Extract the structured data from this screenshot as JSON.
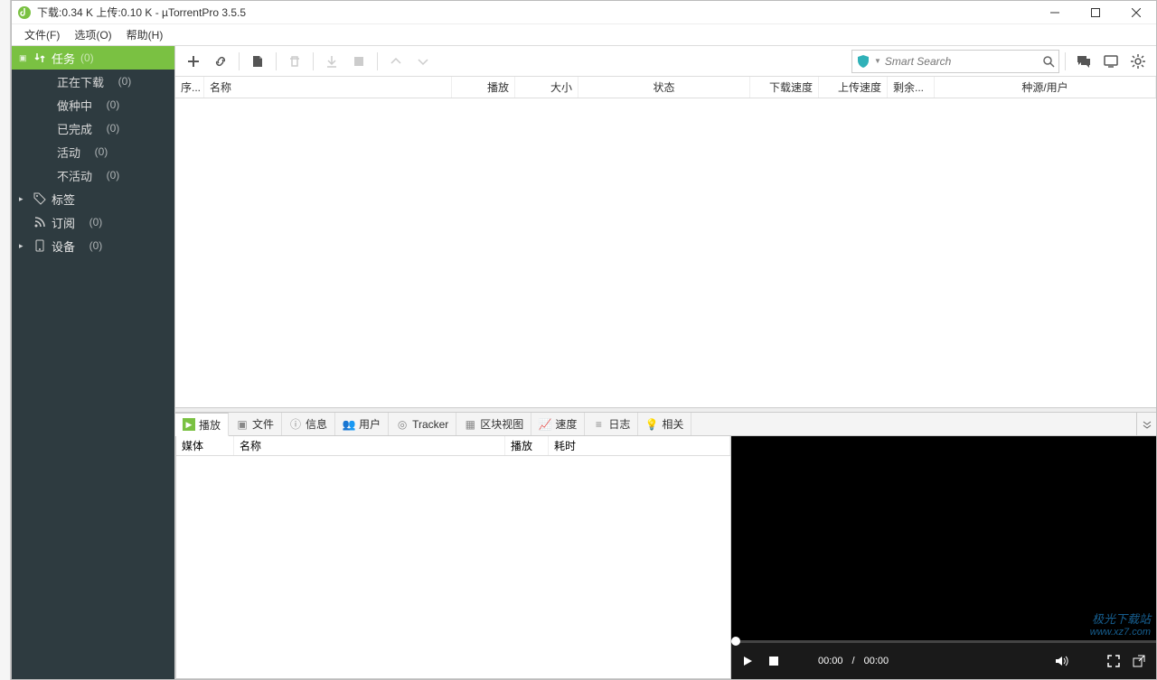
{
  "title": "下载:0.34 K 上传:0.10 K - µTorrentPro 3.5.5",
  "menu": {
    "file": "文件(F)",
    "options": "选项(O)",
    "help": "帮助(H)"
  },
  "sidebar": {
    "tasks": {
      "label": "任务",
      "count": "(0)"
    },
    "children": [
      {
        "label": "正在下载",
        "count": "(0)"
      },
      {
        "label": "做种中",
        "count": "(0)"
      },
      {
        "label": "已完成",
        "count": "(0)"
      },
      {
        "label": "活动",
        "count": "(0)"
      },
      {
        "label": "不活动",
        "count": "(0)"
      }
    ],
    "labels": {
      "label": "标签"
    },
    "feeds": {
      "label": "订阅",
      "count": "(0)"
    },
    "devices": {
      "label": "设备",
      "count": "(0)"
    }
  },
  "search": {
    "placeholder": "Smart Search"
  },
  "columns": {
    "seq": "序...",
    "name": "名称",
    "play": "播放",
    "size": "大小",
    "status": "状态",
    "down": "下载速度",
    "up": "上传速度",
    "remain": "剩余...",
    "peers": "种源/用户"
  },
  "tabs": {
    "play": "播放",
    "files": "文件",
    "info": "信息",
    "users": "用户",
    "tracker": "Tracker",
    "pieces": "区块视图",
    "speed": "速度",
    "log": "日志",
    "related": "相关"
  },
  "media_cols": {
    "media": "媒体",
    "name": "名称",
    "play": "播放",
    "elapsed": "耗时"
  },
  "player": {
    "cur": "00:00",
    "sep": "/",
    "total": "00:00"
  },
  "watermark": {
    "l1": "极光下载站",
    "l2": "www.xz7.com"
  }
}
